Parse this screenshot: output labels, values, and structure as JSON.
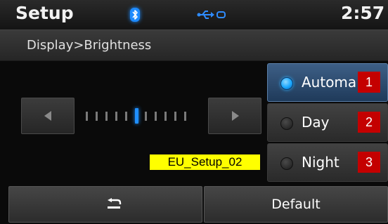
{
  "status": {
    "title": "Setup",
    "clock": "2:57",
    "icons": [
      "bluetooth-icon",
      "usb-icon"
    ],
    "bluetooth_color": "#1e8bff"
  },
  "breadcrumb": "Display>Brightness",
  "brightness": {
    "level_index": 5,
    "total_steps": 11,
    "prev_icon": "arrow-left-icon",
    "next_icon": "arrow-right-icon"
  },
  "caption": "EU_Setup_02",
  "options": [
    {
      "label": "Automa",
      "badge": "1",
      "selected": true
    },
    {
      "label": "Day",
      "badge": "2",
      "selected": false
    },
    {
      "label": "Night",
      "badge": "3",
      "selected": false
    }
  ],
  "buttons": {
    "back_icon": "back-arrow-icon",
    "default_label": "Default"
  },
  "colors": {
    "accent": "#1f8fff",
    "badge": "#c40000",
    "caption_bg": "#ffff00"
  }
}
